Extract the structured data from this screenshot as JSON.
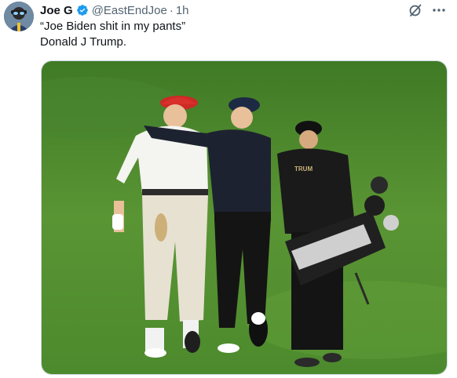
{
  "tweet": {
    "author_name": "Joe G",
    "handle": "@EastEndJoe",
    "separator": "·",
    "time": "1h",
    "text_lines": [
      "“Joe Biden shit in my pants”",
      "Donald J Trump."
    ]
  },
  "icons": {
    "verified": "verified-badge-icon",
    "grok": "grok-icon",
    "more": "more-options-icon"
  },
  "colors": {
    "verified_blue": "#1d9bf0",
    "secondary_text": "#536471",
    "grass": "#4f8a2c"
  },
  "media": {
    "image_text": "TRUM"
  }
}
